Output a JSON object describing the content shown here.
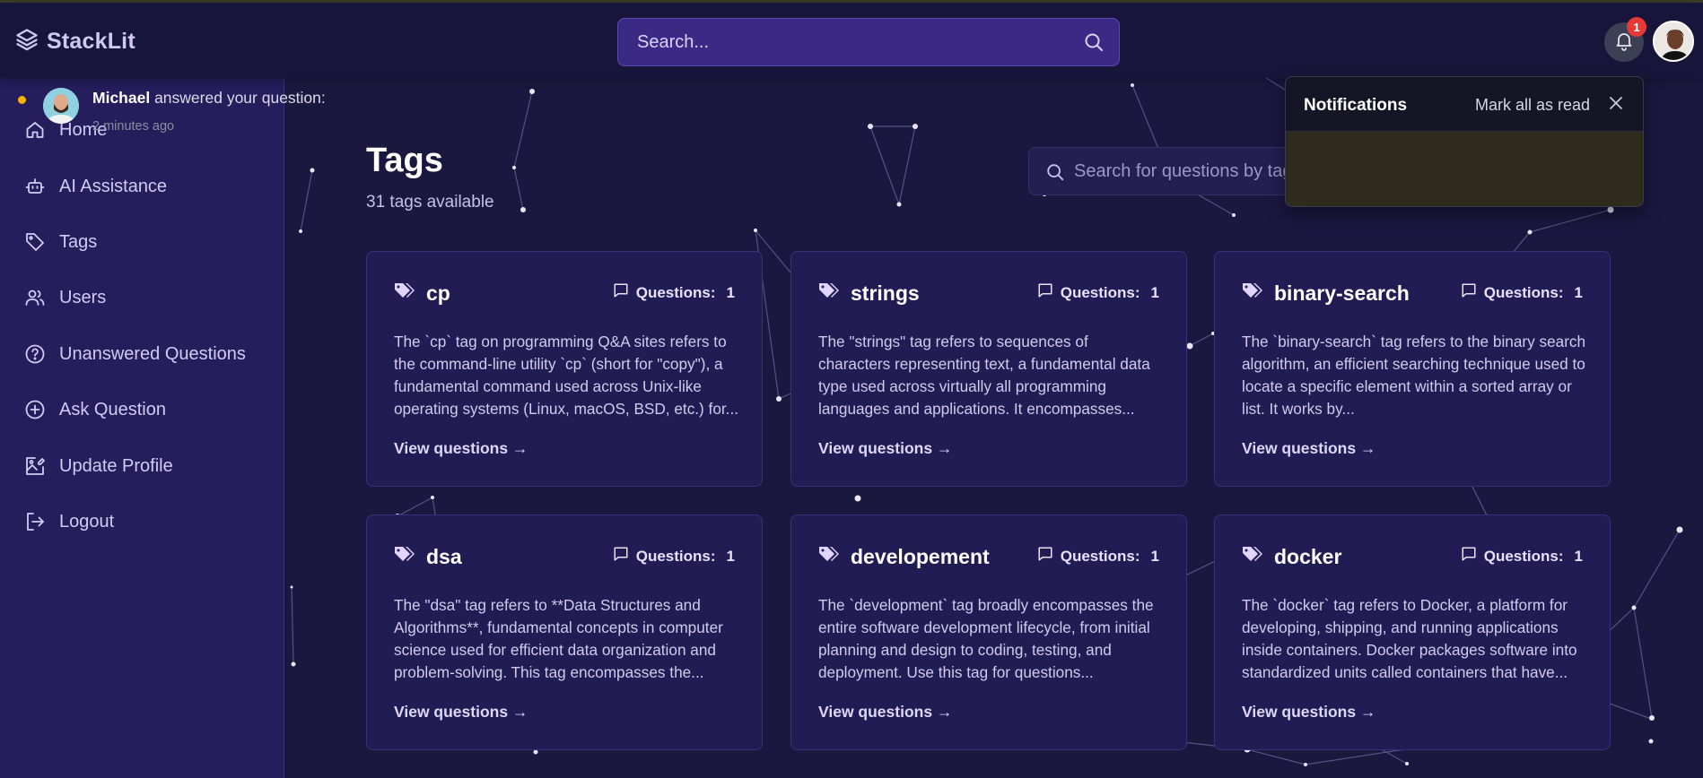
{
  "app": {
    "name": "StackLit"
  },
  "search": {
    "placeholder": "Search..."
  },
  "header": {
    "notification_count": "1"
  },
  "sidebar": {
    "items": [
      {
        "label": "Home",
        "icon": "home-icon"
      },
      {
        "label": "AI Assistance",
        "icon": "robot-icon"
      },
      {
        "label": "Tags",
        "icon": "tag-icon"
      },
      {
        "label": "Users",
        "icon": "users-icon"
      },
      {
        "label": "Unanswered Questions",
        "icon": "question-circle-icon"
      },
      {
        "label": "Ask Question",
        "icon": "plus-circle-icon"
      },
      {
        "label": "Update Profile",
        "icon": "image-edit-icon"
      },
      {
        "label": "Logout",
        "icon": "logout-icon"
      }
    ]
  },
  "main": {
    "title": "Tags",
    "subtitle": "31 tags available",
    "question_search_placeholder": "Search for questions by tag"
  },
  "tags": [
    {
      "name": "cp",
      "count_label": "Questions:",
      "count": "1",
      "description": "The `cp` tag on programming Q&A sites refers to the command-line utility `cp` (short for \"copy\"), a fundamental command used across Unix-like operating systems (Linux, macOS, BSD, etc.) for...",
      "link": "View questions →"
    },
    {
      "name": "strings",
      "count_label": "Questions:",
      "count": "1",
      "description": "The \"strings\" tag refers to sequences of characters representing text, a fundamental data type used across virtually all programming languages and applications. It encompasses...",
      "link": "View questions →"
    },
    {
      "name": "binary-search",
      "count_label": "Questions:",
      "count": "1",
      "description": "The `binary-search` tag refers to the binary search algorithm, an efficient searching technique used to locate a specific element within a sorted array or list. It works by...",
      "link": "View questions →"
    },
    {
      "name": "dsa",
      "count_label": "Questions:",
      "count": "1",
      "description": "The \"dsa\" tag refers to **Data Structures and Algorithms**, fundamental concepts in computer science used for efficient data organization and problem-solving. This tag encompasses the...",
      "link": "View questions →"
    },
    {
      "name": "developement",
      "count_label": "Questions:",
      "count": "1",
      "description": "The `development` tag broadly encompasses the entire software development lifecycle, from initial planning and design to coding, testing, and deployment. Use this tag for questions...",
      "link": "View questions →"
    },
    {
      "name": "docker",
      "count_label": "Questions:",
      "count": "1",
      "description": "The `docker` tag refers to Docker, a platform for developing, shipping, and running applications inside containers. Docker packages software into standardized units called containers that have...",
      "link": "View questions →"
    }
  ],
  "notifications": {
    "title": "Notifications",
    "mark_all": "Mark all as read",
    "items": [
      {
        "user": "Michael",
        "text": "answered your question:",
        "time": "2 minutes ago",
        "unread_color": "#f5b400"
      }
    ]
  },
  "colors": {
    "accent": "#3a2a86",
    "background": "#1b1840",
    "sidebar": "#251d5c",
    "badge": "#e53935"
  }
}
